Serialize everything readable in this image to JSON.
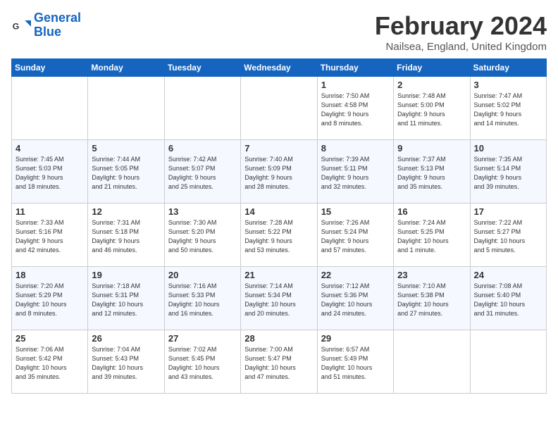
{
  "logo": {
    "line1": "General",
    "line2": "Blue"
  },
  "title": "February 2024",
  "location": "Nailsea, England, United Kingdom",
  "weekdays": [
    "Sunday",
    "Monday",
    "Tuesday",
    "Wednesday",
    "Thursday",
    "Friday",
    "Saturday"
  ],
  "weeks": [
    [
      {
        "day": "",
        "info": ""
      },
      {
        "day": "",
        "info": ""
      },
      {
        "day": "",
        "info": ""
      },
      {
        "day": "",
        "info": ""
      },
      {
        "day": "1",
        "info": "Sunrise: 7:50 AM\nSunset: 4:58 PM\nDaylight: 9 hours\nand 8 minutes."
      },
      {
        "day": "2",
        "info": "Sunrise: 7:48 AM\nSunset: 5:00 PM\nDaylight: 9 hours\nand 11 minutes."
      },
      {
        "day": "3",
        "info": "Sunrise: 7:47 AM\nSunset: 5:02 PM\nDaylight: 9 hours\nand 14 minutes."
      }
    ],
    [
      {
        "day": "4",
        "info": "Sunrise: 7:45 AM\nSunset: 5:03 PM\nDaylight: 9 hours\nand 18 minutes."
      },
      {
        "day": "5",
        "info": "Sunrise: 7:44 AM\nSunset: 5:05 PM\nDaylight: 9 hours\nand 21 minutes."
      },
      {
        "day": "6",
        "info": "Sunrise: 7:42 AM\nSunset: 5:07 PM\nDaylight: 9 hours\nand 25 minutes."
      },
      {
        "day": "7",
        "info": "Sunrise: 7:40 AM\nSunset: 5:09 PM\nDaylight: 9 hours\nand 28 minutes."
      },
      {
        "day": "8",
        "info": "Sunrise: 7:39 AM\nSunset: 5:11 PM\nDaylight: 9 hours\nand 32 minutes."
      },
      {
        "day": "9",
        "info": "Sunrise: 7:37 AM\nSunset: 5:13 PM\nDaylight: 9 hours\nand 35 minutes."
      },
      {
        "day": "10",
        "info": "Sunrise: 7:35 AM\nSunset: 5:14 PM\nDaylight: 9 hours\nand 39 minutes."
      }
    ],
    [
      {
        "day": "11",
        "info": "Sunrise: 7:33 AM\nSunset: 5:16 PM\nDaylight: 9 hours\nand 42 minutes."
      },
      {
        "day": "12",
        "info": "Sunrise: 7:31 AM\nSunset: 5:18 PM\nDaylight: 9 hours\nand 46 minutes."
      },
      {
        "day": "13",
        "info": "Sunrise: 7:30 AM\nSunset: 5:20 PM\nDaylight: 9 hours\nand 50 minutes."
      },
      {
        "day": "14",
        "info": "Sunrise: 7:28 AM\nSunset: 5:22 PM\nDaylight: 9 hours\nand 53 minutes."
      },
      {
        "day": "15",
        "info": "Sunrise: 7:26 AM\nSunset: 5:24 PM\nDaylight: 9 hours\nand 57 minutes."
      },
      {
        "day": "16",
        "info": "Sunrise: 7:24 AM\nSunset: 5:25 PM\nDaylight: 10 hours\nand 1 minute."
      },
      {
        "day": "17",
        "info": "Sunrise: 7:22 AM\nSunset: 5:27 PM\nDaylight: 10 hours\nand 5 minutes."
      }
    ],
    [
      {
        "day": "18",
        "info": "Sunrise: 7:20 AM\nSunset: 5:29 PM\nDaylight: 10 hours\nand 8 minutes."
      },
      {
        "day": "19",
        "info": "Sunrise: 7:18 AM\nSunset: 5:31 PM\nDaylight: 10 hours\nand 12 minutes."
      },
      {
        "day": "20",
        "info": "Sunrise: 7:16 AM\nSunset: 5:33 PM\nDaylight: 10 hours\nand 16 minutes."
      },
      {
        "day": "21",
        "info": "Sunrise: 7:14 AM\nSunset: 5:34 PM\nDaylight: 10 hours\nand 20 minutes."
      },
      {
        "day": "22",
        "info": "Sunrise: 7:12 AM\nSunset: 5:36 PM\nDaylight: 10 hours\nand 24 minutes."
      },
      {
        "day": "23",
        "info": "Sunrise: 7:10 AM\nSunset: 5:38 PM\nDaylight: 10 hours\nand 27 minutes."
      },
      {
        "day": "24",
        "info": "Sunrise: 7:08 AM\nSunset: 5:40 PM\nDaylight: 10 hours\nand 31 minutes."
      }
    ],
    [
      {
        "day": "25",
        "info": "Sunrise: 7:06 AM\nSunset: 5:42 PM\nDaylight: 10 hours\nand 35 minutes."
      },
      {
        "day": "26",
        "info": "Sunrise: 7:04 AM\nSunset: 5:43 PM\nDaylight: 10 hours\nand 39 minutes."
      },
      {
        "day": "27",
        "info": "Sunrise: 7:02 AM\nSunset: 5:45 PM\nDaylight: 10 hours\nand 43 minutes."
      },
      {
        "day": "28",
        "info": "Sunrise: 7:00 AM\nSunset: 5:47 PM\nDaylight: 10 hours\nand 47 minutes."
      },
      {
        "day": "29",
        "info": "Sunrise: 6:57 AM\nSunset: 5:49 PM\nDaylight: 10 hours\nand 51 minutes."
      },
      {
        "day": "",
        "info": ""
      },
      {
        "day": "",
        "info": ""
      }
    ]
  ]
}
